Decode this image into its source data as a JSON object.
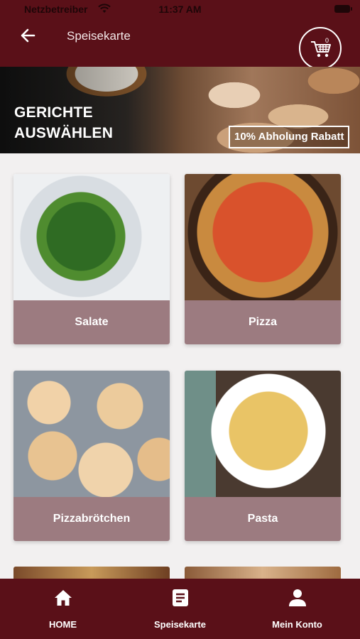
{
  "status_bar": {
    "carrier": "Netzbetreiber",
    "time": "11:37 AM"
  },
  "app_bar": {
    "title": "Speisekarte",
    "cart_count": "0"
  },
  "banner": {
    "headline": "GERICHTE AUSWÄHLEN",
    "promo": "10% Abholung Rabatt"
  },
  "categories": [
    {
      "label": "Salate"
    },
    {
      "label": "Pizza"
    },
    {
      "label": "Pizzabrötchen"
    },
    {
      "label": "Pasta"
    }
  ],
  "bottom_nav": [
    {
      "label": "HOME",
      "icon": "home-icon"
    },
    {
      "label": "Speisekarte",
      "icon": "menu-book-icon"
    },
    {
      "label": "Mein Konto",
      "icon": "person-icon"
    }
  ],
  "colors": {
    "primary": "#5a1018",
    "card_label_bg": "#9c7b80",
    "background": "#f2f0f0"
  }
}
